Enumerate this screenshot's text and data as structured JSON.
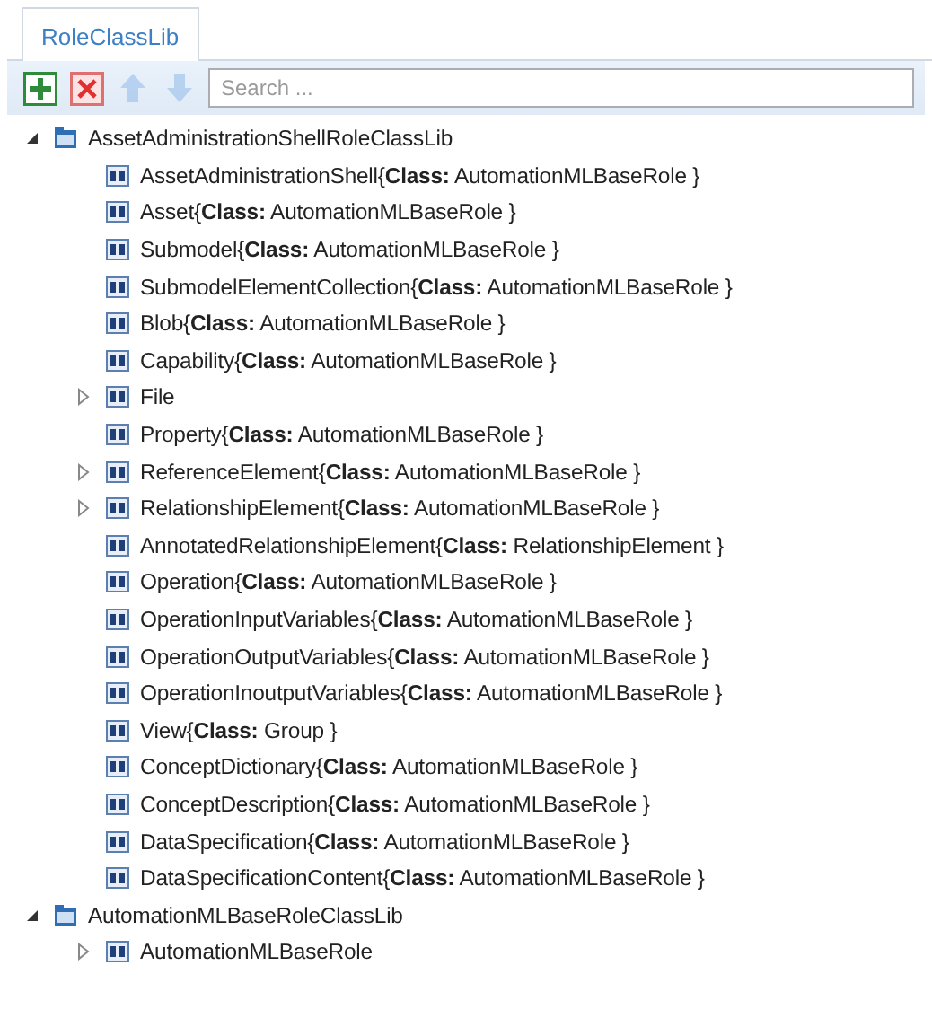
{
  "tabs": [
    {
      "label": "RoleClassLib",
      "selected": true
    }
  ],
  "toolbar": {
    "buttons": [
      {
        "kind": "add",
        "disabled": false
      },
      {
        "kind": "delete",
        "disabled": false
      },
      {
        "kind": "up",
        "disabled": true
      },
      {
        "kind": "down",
        "disabled": true
      }
    ],
    "search": {
      "placeholder": "Search ..."
    }
  },
  "tree": [
    {
      "kind": "library",
      "label": "AssetAdministrationShellRoleClassLib",
      "expandable": true,
      "expanded": true,
      "children": [
        {
          "kind": "role",
          "label": "AssetAdministrationShell{**Class:** AutomationMLBaseRole }",
          "expandable": false
        },
        {
          "kind": "role",
          "label": "Asset{**Class:** AutomationMLBaseRole }",
          "expandable": false
        },
        {
          "kind": "role",
          "label": "Submodel{**Class:** AutomationMLBaseRole }",
          "expandable": false
        },
        {
          "kind": "role",
          "label": "SubmodelElementCollection{**Class:** AutomationMLBaseRole }",
          "expandable": false
        },
        {
          "kind": "role",
          "label": "Blob{**Class:** AutomationMLBaseRole }",
          "expandable": false
        },
        {
          "kind": "role",
          "label": "Capability{**Class:** AutomationMLBaseRole }",
          "expandable": false
        },
        {
          "kind": "role",
          "label": "File",
          "expandable": true
        },
        {
          "kind": "role",
          "label": "Property{**Class:** AutomationMLBaseRole }",
          "expandable": false
        },
        {
          "kind": "role",
          "label": "ReferenceElement{**Class:** AutomationMLBaseRole }",
          "expandable": true
        },
        {
          "kind": "role",
          "label": "RelationshipElement{**Class:** AutomationMLBaseRole }",
          "expandable": true
        },
        {
          "kind": "role",
          "label": "AnnotatedRelationshipElement{**Class:** RelationshipElement }",
          "expandable": false
        },
        {
          "kind": "role",
          "label": "Operation{**Class:** AutomationMLBaseRole }",
          "expandable": false
        },
        {
          "kind": "role",
          "label": "OperationInputVariables{**Class:** AutomationMLBaseRole }",
          "expandable": false
        },
        {
          "kind": "role",
          "label": "OperationOutputVariables{**Class:** AutomationMLBaseRole }",
          "expandable": false
        },
        {
          "kind": "role",
          "label": "OperationInoutputVariables{**Class:** AutomationMLBaseRole }",
          "expandable": false
        },
        {
          "kind": "role",
          "label": "View{**Class:** Group }",
          "expandable": false
        },
        {
          "kind": "role",
          "label": "ConceptDictionary{**Class:** AutomationMLBaseRole }",
          "expandable": false
        },
        {
          "kind": "role",
          "label": "ConceptDescription{**Class:** AutomationMLBaseRole }",
          "expandable": false
        },
        {
          "kind": "role",
          "label": "DataSpecification{**Class:** AutomationMLBaseRole }",
          "expandable": false
        },
        {
          "kind": "role",
          "label": "DataSpecificationContent{**Class:** AutomationMLBaseRole }",
          "expandable": false
        }
      ]
    },
    {
      "kind": "library",
      "label": "AutomationMLBaseRoleClassLib",
      "expandable": true,
      "expanded": true,
      "children": [
        {
          "kind": "role",
          "label": "AutomationMLBaseRole",
          "expandable": true
        }
      ]
    }
  ]
}
